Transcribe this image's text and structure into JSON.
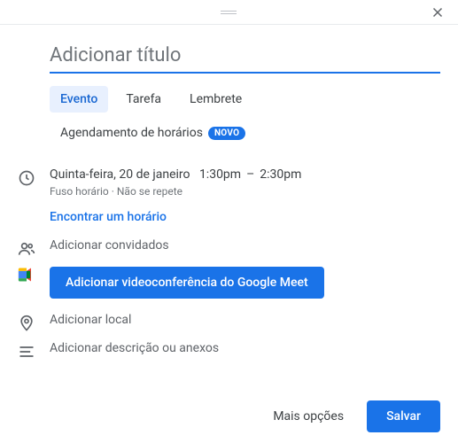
{
  "title_placeholder": "Adicionar título",
  "tabs": {
    "event": "Evento",
    "task": "Tarefa",
    "reminder": "Lembrete",
    "scheduling": "Agendamento de horários",
    "badge": "NOVO"
  },
  "datetime": {
    "date": "Quinta-feira, 20 de janeiro",
    "start": "1:30pm",
    "sep": "–",
    "end": "2:30pm",
    "tz": "Fuso horário",
    "repeat": "Não se repete",
    "find_time": "Encontrar um horário"
  },
  "guests": {
    "placeholder": "Adicionar convidados"
  },
  "meet": {
    "button": "Adicionar videoconferência do Google Meet"
  },
  "location": {
    "placeholder": "Adicionar local"
  },
  "description": {
    "placeholder": "Adicionar descrição ou anexos"
  },
  "footer": {
    "more": "Mais opções",
    "save": "Salvar"
  }
}
